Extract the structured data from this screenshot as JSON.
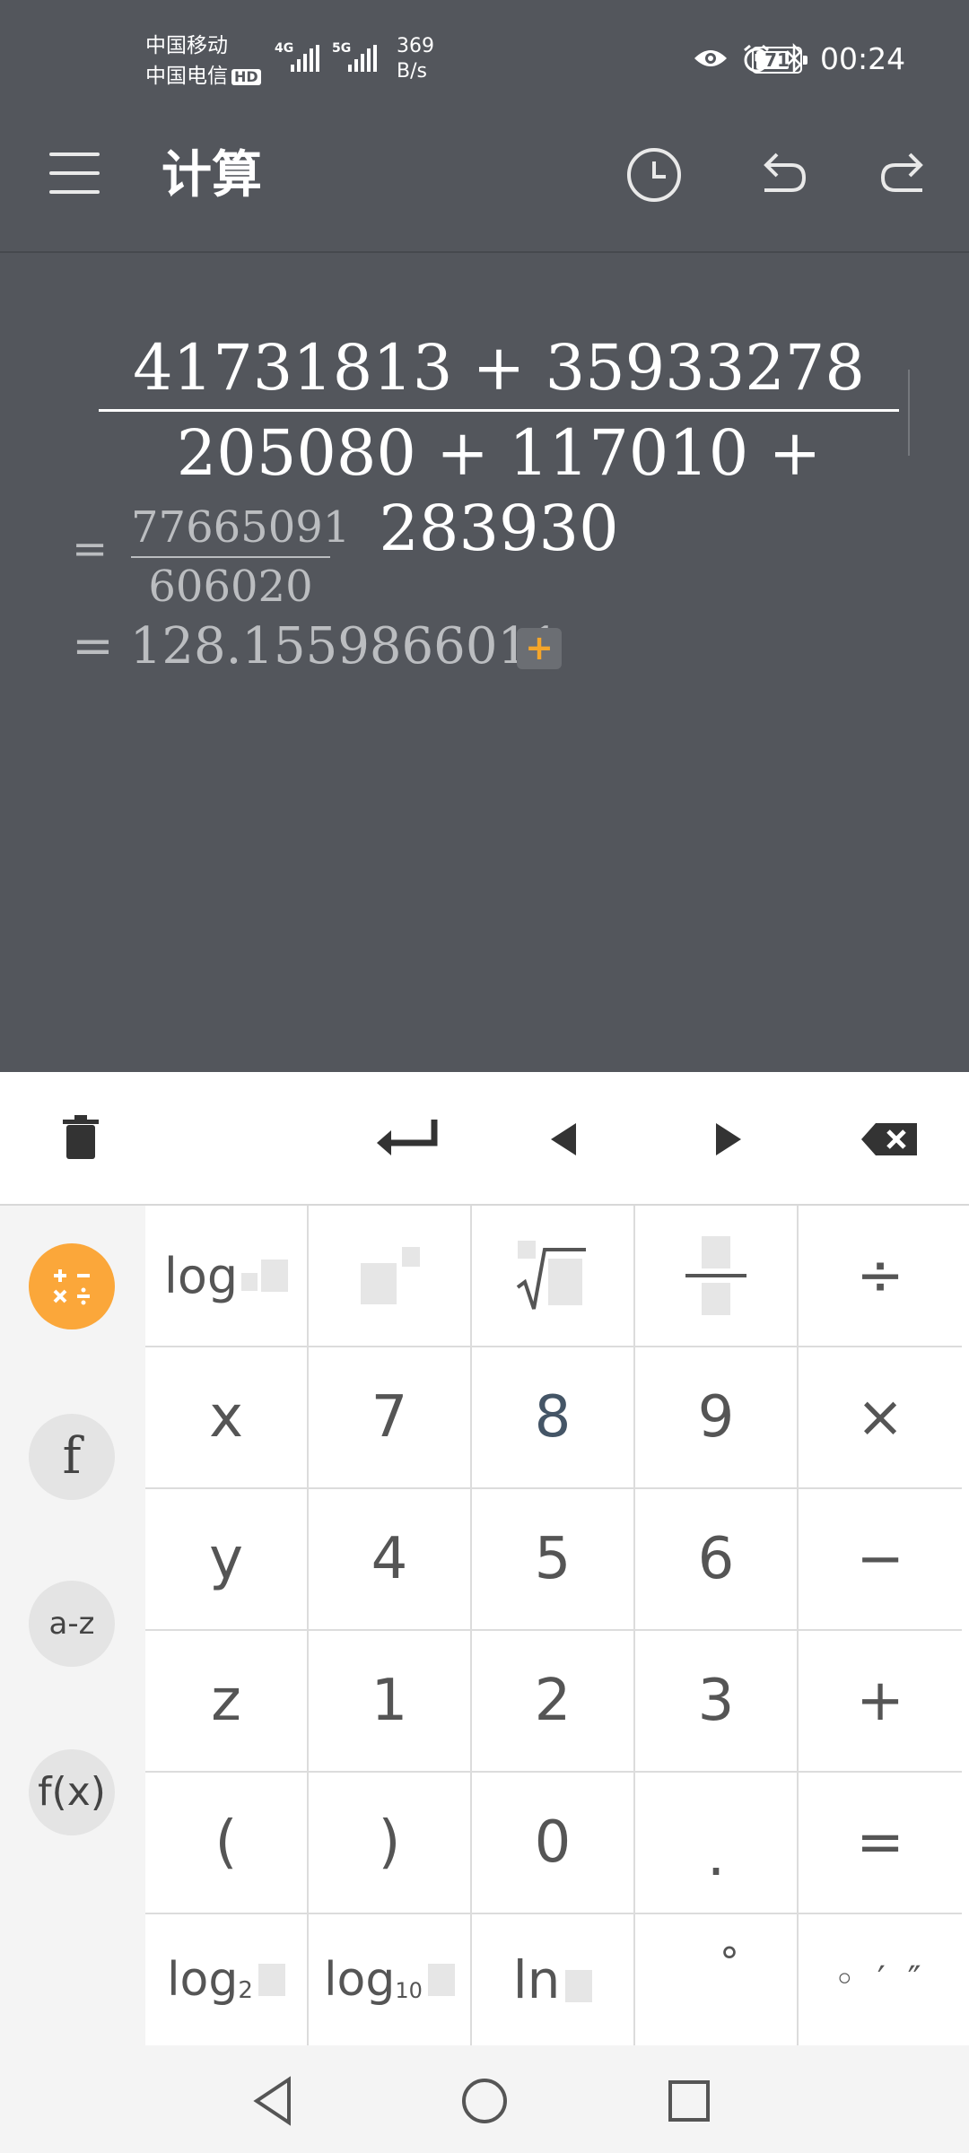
{
  "status_bar": {
    "carrier1": "中国移动",
    "carrier2": "中国电信",
    "hd_badge": "HD",
    "sig1": "4G",
    "sig2": "5G",
    "speed_value": "369",
    "speed_unit": "B/s",
    "battery": "71",
    "time": "00:24"
  },
  "app_bar": {
    "title": "计算",
    "icons": [
      "menu-icon",
      "history-icon",
      "undo-icon",
      "redo-icon"
    ]
  },
  "display": {
    "numerator": "41731813 + 35933278",
    "denominator": "205080 + 117010 + 283930",
    "eq_sign": "=",
    "fraction_numerator": "77665091",
    "fraction_denominator": "606020",
    "decimal_result": "= 128.1559866011",
    "add_label": "+"
  },
  "toolbar": {
    "icons": [
      "trash-icon",
      "enter-icon",
      "left-arrow-icon",
      "right-arrow-icon",
      "backspace-icon"
    ]
  },
  "categories": [
    {
      "label": "+ −\n× ÷",
      "active": true
    },
    {
      "label": "f"
    },
    {
      "label": "a-z"
    },
    {
      "label": "f(x)"
    }
  ],
  "keypad": {
    "row1": [
      "log",
      "x²",
      "√",
      "a/b",
      "÷"
    ],
    "row2": [
      "x",
      "7",
      "8",
      "9",
      "×"
    ],
    "row3": [
      "y",
      "4",
      "5",
      "6",
      "−"
    ],
    "row4": [
      "z",
      "1",
      "2",
      "3",
      "+"
    ],
    "row5": [
      "(",
      ")",
      "0",
      ".",
      "="
    ],
    "row6": [
      "log₂",
      "log₁₀",
      "ln",
      "°",
      "° ′ ″"
    ],
    "log": "log",
    "log2_main": "log",
    "log2_sub": "2",
    "log10_main": "log",
    "log10_sub": "10",
    "ln": "ln",
    "degree": "°",
    "dms": "◦ ′ ″"
  },
  "nav_bar": {
    "icons": [
      "back-icon",
      "home-icon",
      "recents-icon"
    ]
  },
  "colors": {
    "background": "#53565c",
    "accent": "#fba73a",
    "keypad": "#ffffff"
  }
}
